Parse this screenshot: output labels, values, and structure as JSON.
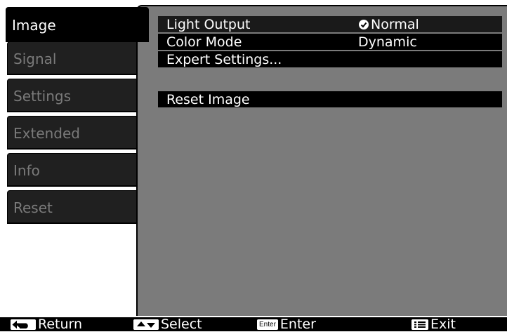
{
  "tabs": [
    {
      "label": "Image",
      "active": true
    },
    {
      "label": "Signal",
      "active": false
    },
    {
      "label": "Settings",
      "active": false
    },
    {
      "label": "Extended",
      "active": false
    },
    {
      "label": "Info",
      "active": false
    },
    {
      "label": "Reset",
      "active": false
    }
  ],
  "menu": {
    "light_output": {
      "label": "Light Output",
      "value": "Normal",
      "value_icon": "check-icon"
    },
    "color_mode": {
      "label": "Color Mode",
      "value": "Dynamic"
    },
    "expert_settings": {
      "label": "Expert Settings..."
    },
    "reset_image": {
      "label": "Reset Image"
    }
  },
  "footer": {
    "return": {
      "label": "Return",
      "icon": "return-icon"
    },
    "select": {
      "label": "Select",
      "icon": "up-down-arrows-icon"
    },
    "enter": {
      "label": "Enter",
      "key": "Enter"
    },
    "exit": {
      "label": "Exit",
      "icon": "menu-icon"
    }
  }
}
